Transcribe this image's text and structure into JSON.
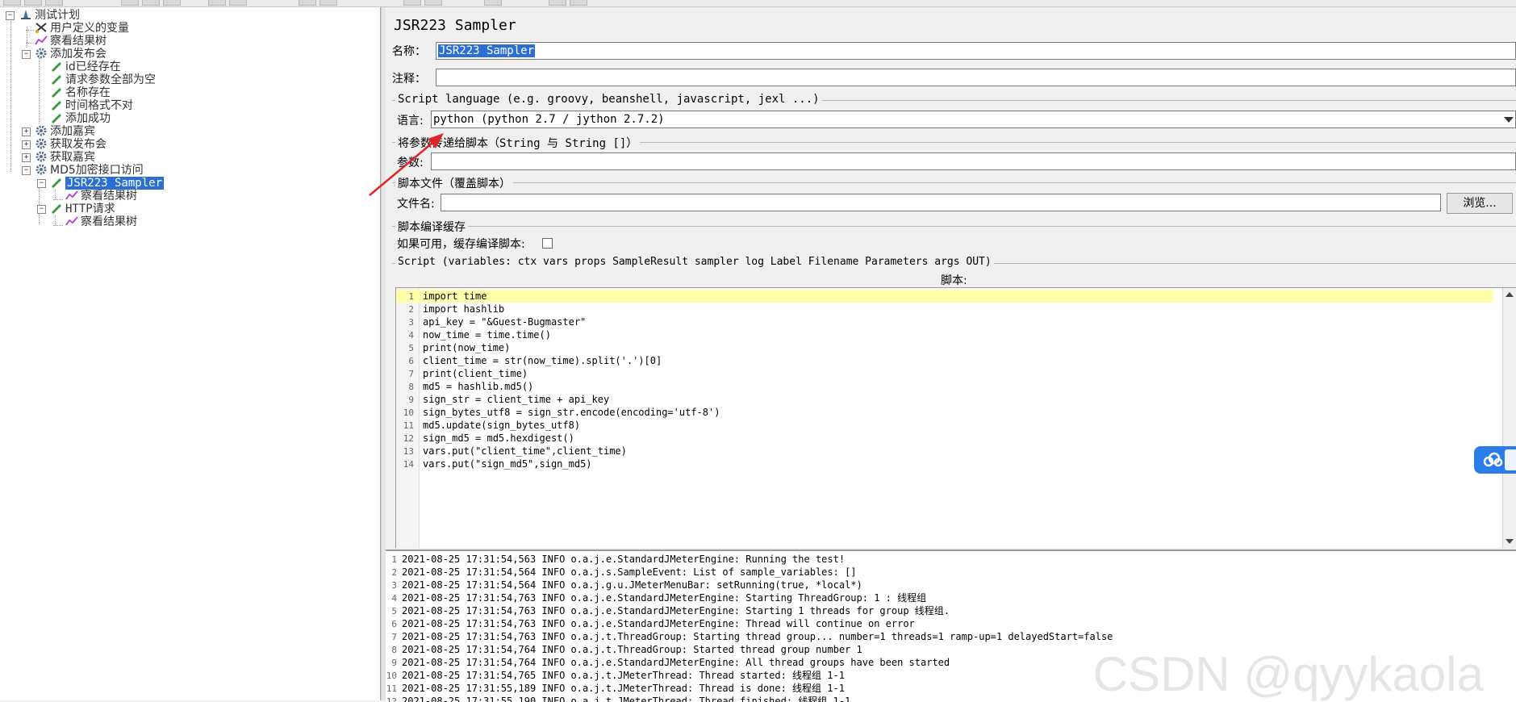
{
  "tree": {
    "items": [
      {
        "label": "测试计划",
        "icon": "test-plan-icon"
      },
      {
        "label": "用户定义的变量",
        "icon": "scissors-icon"
      },
      {
        "label": "察看结果树",
        "icon": "chart-icon"
      },
      {
        "label": "添加发布会",
        "icon": "gear-icon"
      },
      {
        "label": "id已经存在",
        "icon": "pencil-icon"
      },
      {
        "label": "请求参数全部为空",
        "icon": "pencil-icon"
      },
      {
        "label": "名称存在",
        "icon": "pencil-icon"
      },
      {
        "label": "时间格式不对",
        "icon": "pencil-icon"
      },
      {
        "label": "添加成功",
        "icon": "pencil-icon"
      },
      {
        "label": "添加嘉宾",
        "icon": "gear-icon"
      },
      {
        "label": "获取发布会",
        "icon": "gear-icon"
      },
      {
        "label": "获取嘉宾",
        "icon": "gear-icon"
      },
      {
        "label": "MD5加密接口访问",
        "icon": "gear-icon"
      },
      {
        "label": "JSR223 Sampler",
        "icon": "pencil-icon"
      },
      {
        "label": "察看结果树",
        "icon": "chart-icon"
      },
      {
        "label": "HTTP请求",
        "icon": "pencil-icon"
      },
      {
        "label": "察看结果树",
        "icon": "chart-icon"
      }
    ]
  },
  "panel": {
    "title": "JSR223 Sampler",
    "name_label": "名称：",
    "name_value": "JSR223 Sampler",
    "comment_label": "注释：",
    "comment_value": "",
    "script_language_group": "Script language (e.g. groovy, beanshell, javascript, jexl ...)",
    "language_label": "语言:",
    "language_value": "python     (python 2.7 / jython 2.7.2)",
    "params_group": "将参数传递给脚本（String 与 String []）",
    "params_label": "参数:",
    "params_value": "",
    "script_file_group": "脚本文件（覆盖脚本）",
    "file_label": "文件名:",
    "file_value": "",
    "browse_button": "浏览...",
    "cache_group": "脚本编译缓存",
    "cache_label": "如果可用，缓存编译脚本:",
    "script_group": "Script (variables: ctx vars props SampleResult sampler log Label Filename Parameters args OUT)",
    "script_label": "脚本:"
  },
  "code": [
    {
      "n": "1",
      "text": "import time"
    },
    {
      "n": "2",
      "text": "import hashlib"
    },
    {
      "n": "3",
      "text": "api_key = \"&Guest-Bugmaster\""
    },
    {
      "n": "4",
      "text": "now_time = time.time()"
    },
    {
      "n": "5",
      "text": "print(now_time)"
    },
    {
      "n": "6",
      "text": "client_time = str(now_time).split('.')[0]"
    },
    {
      "n": "7",
      "text": "print(client_time)"
    },
    {
      "n": "8",
      "text": "md5 = hashlib.md5()"
    },
    {
      "n": "9",
      "text": "sign_str = client_time + api_key"
    },
    {
      "n": "10",
      "text": "sign_bytes_utf8 = sign_str.encode(encoding='utf-8')"
    },
    {
      "n": "11",
      "text": "md5.update(sign_bytes_utf8)"
    },
    {
      "n": "12",
      "text": "sign_md5 = md5.hexdigest()"
    },
    {
      "n": "13",
      "text": "vars.put(\"client_time\",client_time)"
    },
    {
      "n": "14",
      "text": "vars.put(\"sign_md5\",sign_md5)"
    }
  ],
  "log": [
    {
      "n": "1",
      "text": "2021-08-25 17:31:54,563 INFO o.a.j.e.StandardJMeterEngine: Running the test!"
    },
    {
      "n": "2",
      "text": "2021-08-25 17:31:54,564 INFO o.a.j.s.SampleEvent: List of sample_variables: []"
    },
    {
      "n": "3",
      "text": "2021-08-25 17:31:54,564 INFO o.a.j.g.u.JMeterMenuBar: setRunning(true, *local*)"
    },
    {
      "n": "4",
      "text": "2021-08-25 17:31:54,763 INFO o.a.j.e.StandardJMeterEngine: Starting ThreadGroup: 1 : 线程组"
    },
    {
      "n": "5",
      "text": "2021-08-25 17:31:54,763 INFO o.a.j.e.StandardJMeterEngine: Starting 1 threads for group 线程组."
    },
    {
      "n": "6",
      "text": "2021-08-25 17:31:54,763 INFO o.a.j.e.StandardJMeterEngine: Thread will continue on error"
    },
    {
      "n": "7",
      "text": "2021-08-25 17:31:54,763 INFO o.a.j.t.ThreadGroup: Starting thread group... number=1 threads=1 ramp-up=1 delayedStart=false"
    },
    {
      "n": "8",
      "text": "2021-08-25 17:31:54,764 INFO o.a.j.t.ThreadGroup: Started thread group number 1"
    },
    {
      "n": "9",
      "text": "2021-08-25 17:31:54,764 INFO o.a.j.e.StandardJMeterEngine: All thread groups have been started"
    },
    {
      "n": "10",
      "text": "2021-08-25 17:31:54,765 INFO o.a.j.t.JMeterThread: Thread started: 线程组 1-1"
    },
    {
      "n": "11",
      "text": "2021-08-25 17:31:55,189 INFO o.a.j.t.JMeterThread: Thread is done: 线程组 1-1"
    },
    {
      "n": "12",
      "text": "2021-08-25 17:31:55,190 INFO o.a.j.t.JMeterThread: Thread finished: 线程组 1-1"
    }
  ],
  "watermark": "CSDN @qyykaola",
  "colors": {
    "selection": "#2b6fd6",
    "highlight_line": "#ffffaa",
    "arrow": "#e0242a",
    "cloud": "#2b7de9"
  }
}
